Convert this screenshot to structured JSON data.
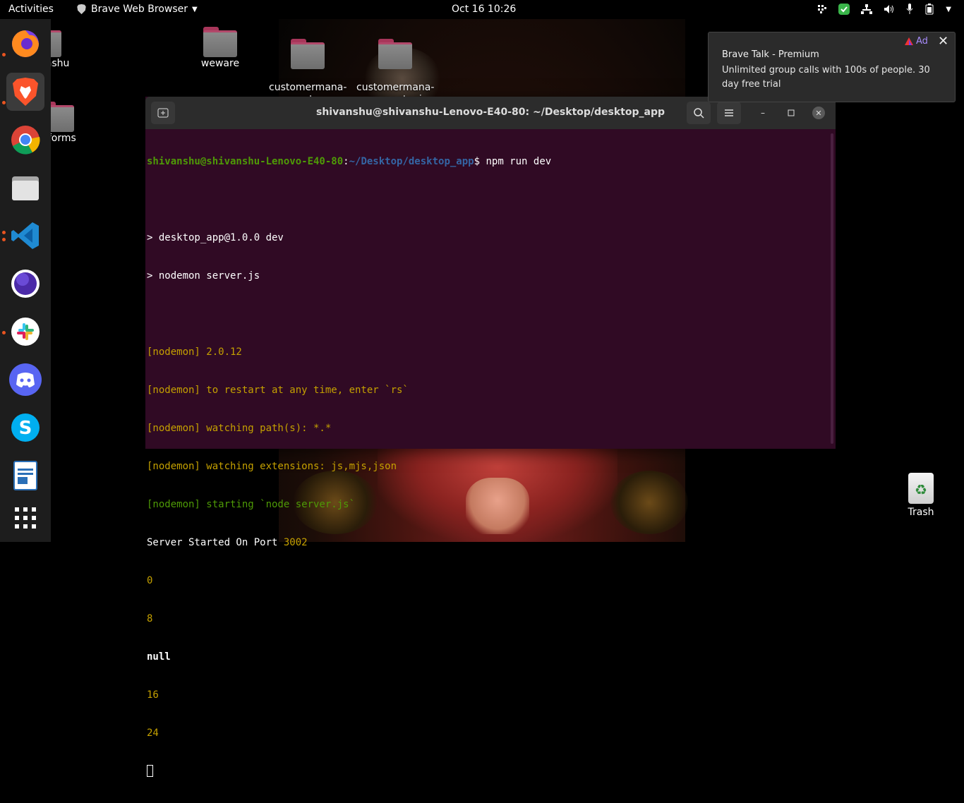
{
  "topbar": {
    "activities": "Activities",
    "app_menu": "Brave Web Browser",
    "clock": "Oct 16  10:26"
  },
  "desktop": {
    "icons": [
      {
        "label": "shivanshu"
      },
      {
        "label": "weware"
      },
      {
        "label": "customermana-\ngement_saas"
      },
      {
        "label": "customermana-\ngementapi"
      },
      {
        "label": "e-forms"
      }
    ],
    "trash": "Trash"
  },
  "dock": {
    "apps": [
      {
        "name": "firefox-icon",
        "running": true
      },
      {
        "name": "brave-icon",
        "running": true,
        "active": true
      },
      {
        "name": "chrome-icon",
        "running": false
      },
      {
        "name": "files-icon",
        "running": false
      },
      {
        "name": "vscode-icon",
        "running": true
      },
      {
        "name": "eclipse-icon",
        "running": false
      },
      {
        "name": "slack-icon",
        "running": true
      },
      {
        "name": "discord-icon",
        "running": false
      },
      {
        "name": "skype-icon",
        "running": false
      },
      {
        "name": "writer-icon",
        "running": false
      },
      {
        "name": "app-grid-icon",
        "running": false
      }
    ]
  },
  "terminal": {
    "title": "shivanshu@shivanshu-Lenovo-E40-80: ~/Desktop/desktop_app",
    "prompt_user": "shivanshu@shivanshu-Lenovo-E40-80",
    "prompt_sep": ":",
    "prompt_path": "~/Desktop/desktop_app",
    "prompt_end": "$ ",
    "command": "npm run dev",
    "lines": [
      "",
      "> desktop_app@1.0.0 dev",
      "> nodemon server.js",
      "",
      "[nodemon] 2.0.12",
      "[nodemon] to restart at any time, enter `rs`",
      "[nodemon] watching path(s): *.*",
      "[nodemon] watching extensions: js,mjs,json",
      "[nodemon] starting `node server.js`",
      "Server Started On Port ",
      "0",
      "8",
      "null",
      "16",
      "24"
    ],
    "port": "3002"
  },
  "notification": {
    "ad_label": "Ad",
    "title": "Brave Talk - Premium",
    "body": "Unlimited group calls with 100s of people. 30 day free trial"
  },
  "colors": {
    "terminal_bg": "#300a24",
    "prompt_green": "#4e9a06",
    "prompt_blue": "#3465a4",
    "nodemon_yellow": "#c4a000",
    "ubuntu_orange": "#e95420"
  }
}
